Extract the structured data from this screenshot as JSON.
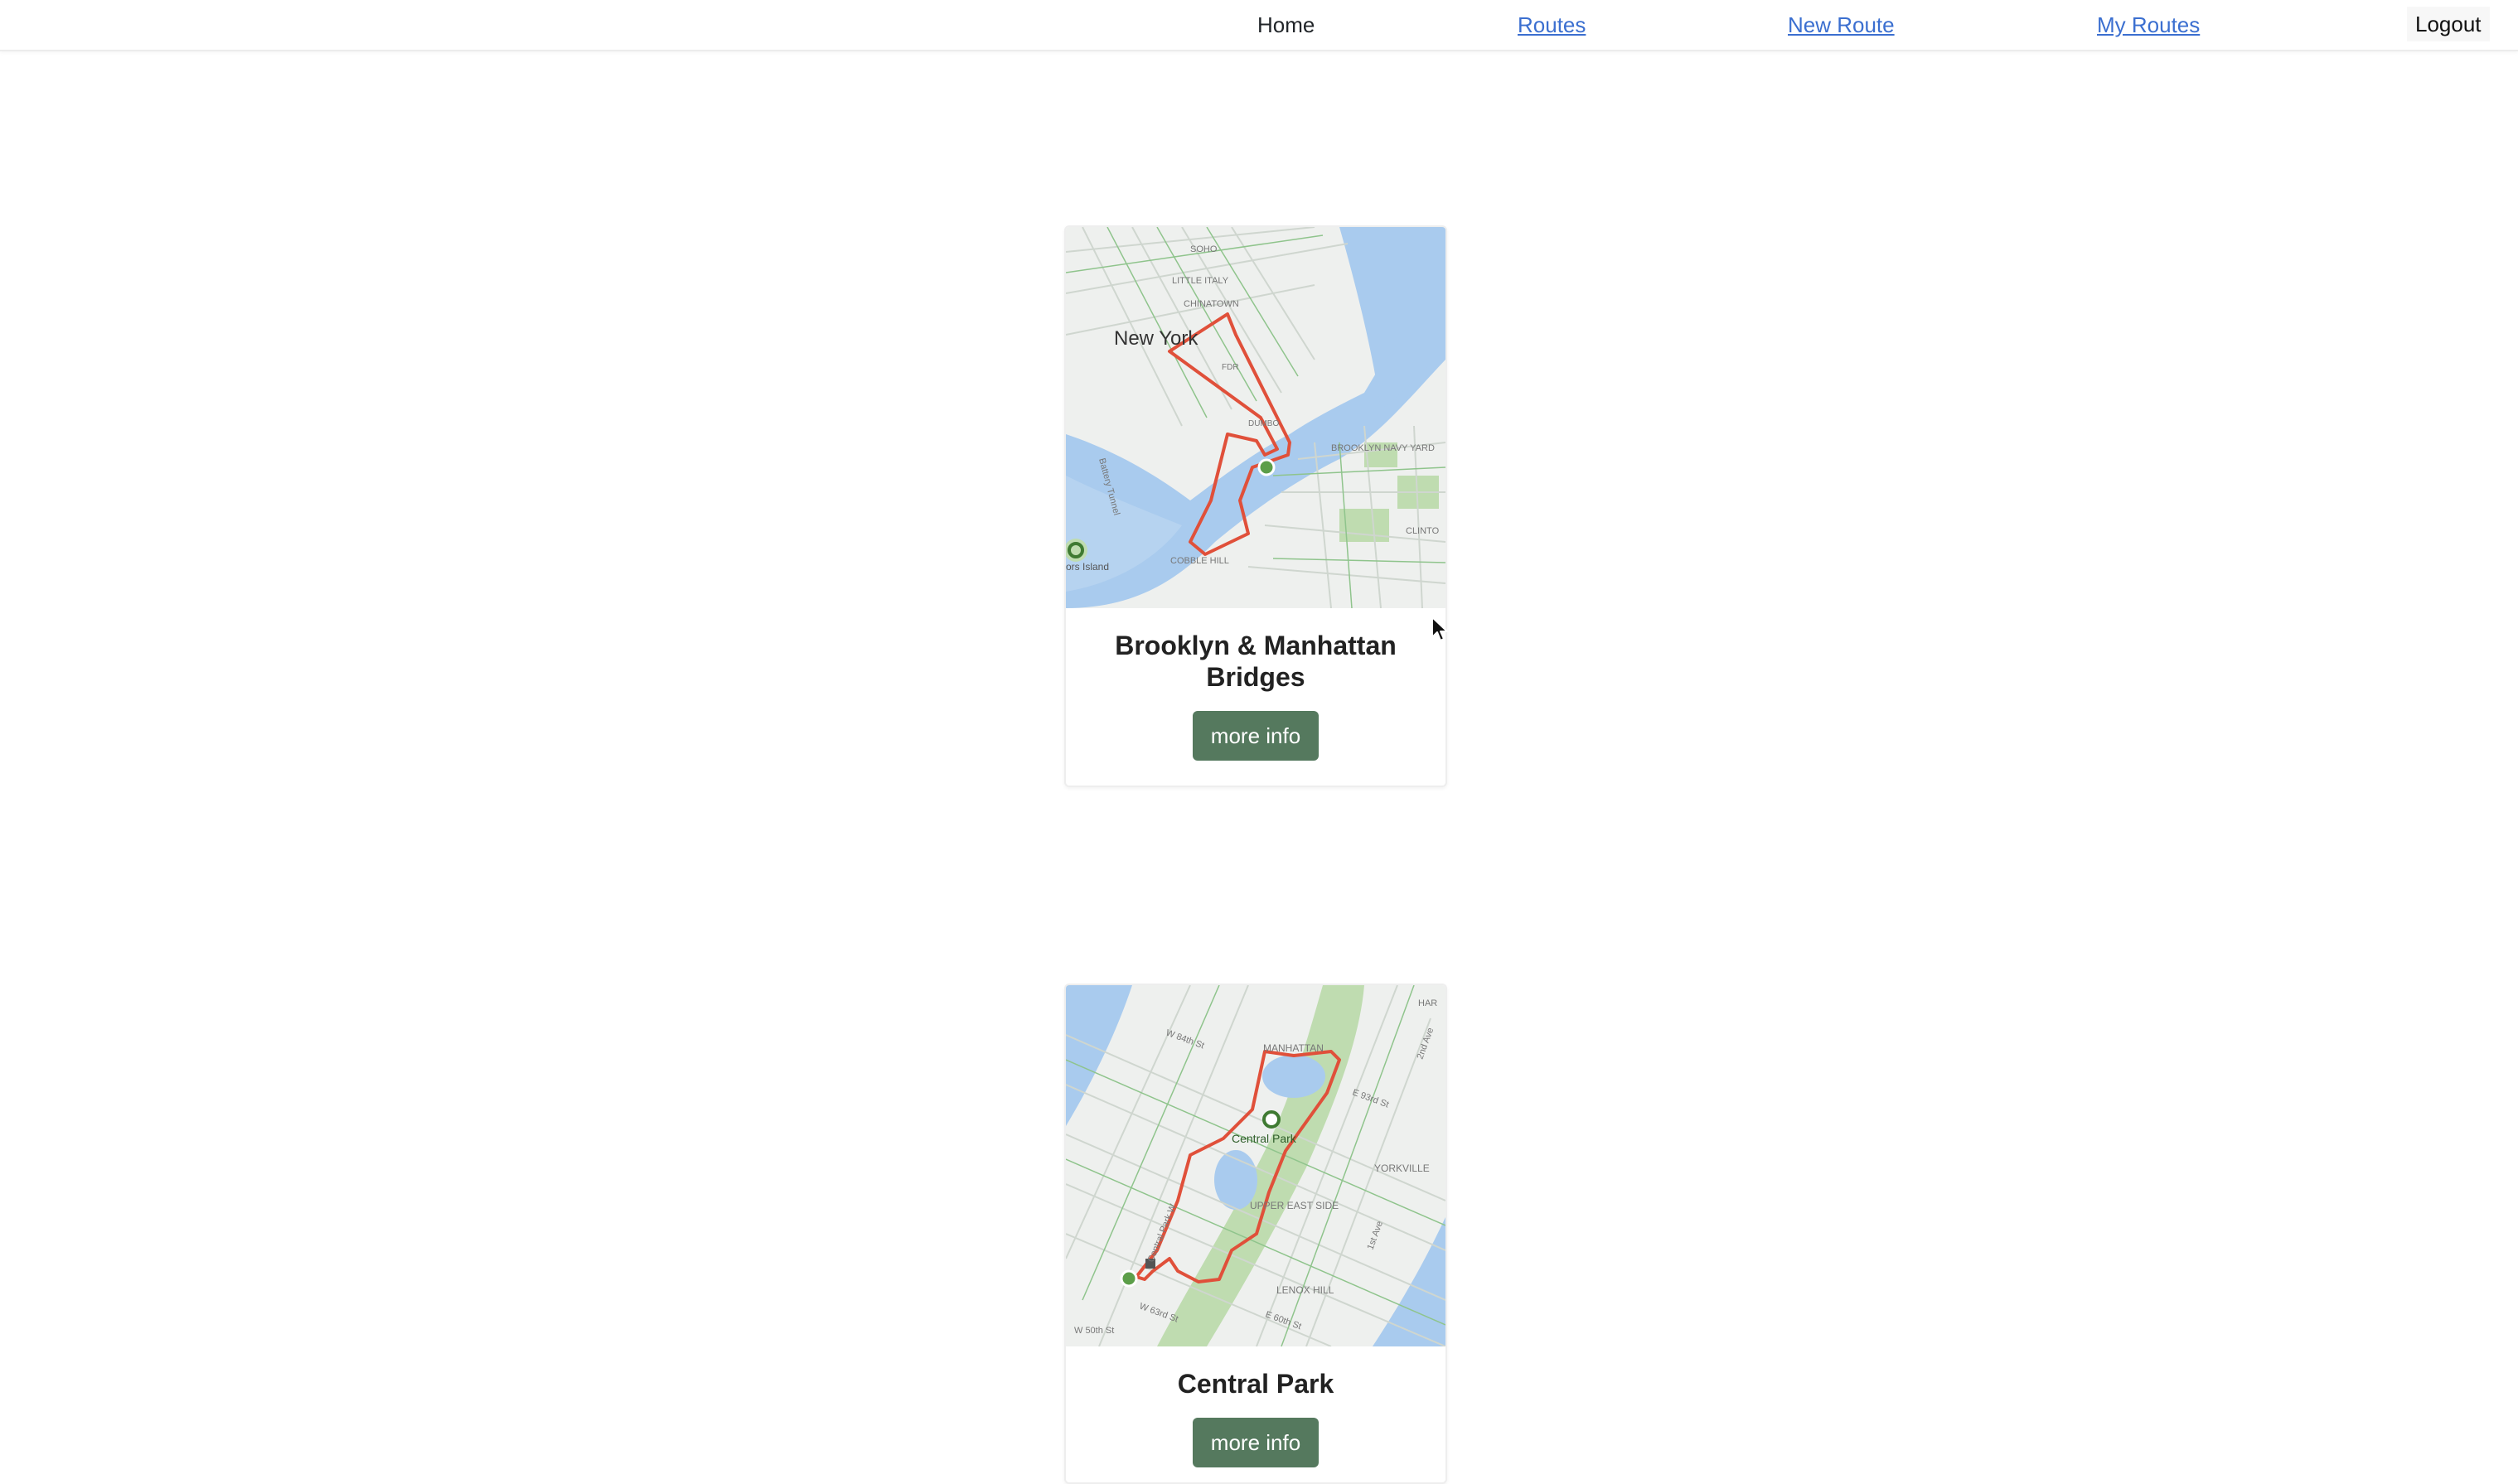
{
  "nav": {
    "home": "Home",
    "routes": "Routes",
    "new_route": "New Route",
    "my_routes": "My Routes",
    "logout": "Logout"
  },
  "routes": [
    {
      "title": "Brooklyn & Manhattan Bridges",
      "button": "more info",
      "map_labels": {
        "city": "New York",
        "soho": "SOHO",
        "little_italy": "LITTLE ITALY",
        "chinatown": "CHINATOWN",
        "fdr": "FDR",
        "dumbo": "DUMBO",
        "brooklyn_navy_yard": "BROOKLYN NAVY YARD",
        "clinton": "CLINTO",
        "cobble_hill": "COBBLE HILL",
        "battery_tunnel": "Battery Tunnel",
        "island": "ors Island"
      }
    },
    {
      "title": "Central Park",
      "button": "more info",
      "map_labels": {
        "park": "Central Park",
        "manhattan": "MANHATTAN",
        "upper_east_side": "UPPER EAST SIDE",
        "yorkville": "YORKVILLE",
        "lenox_hill": "LENOX HILL",
        "w84": "W 84th St",
        "w63": "W 63rd St",
        "w50": "W 50th St",
        "e93": "E 93rd St",
        "e60": "E 60th St",
        "cpw": "Central Park W",
        "second_ave": "2nd Ave",
        "first_ave": "1st Ave",
        "har": "HAR"
      }
    }
  ],
  "colors": {
    "link": "#3b6fd0",
    "button": "#55795e",
    "route_line": "#e0503a",
    "water": "#a9cbee",
    "park": "#bfdcb0",
    "land": "#eef0ee"
  }
}
